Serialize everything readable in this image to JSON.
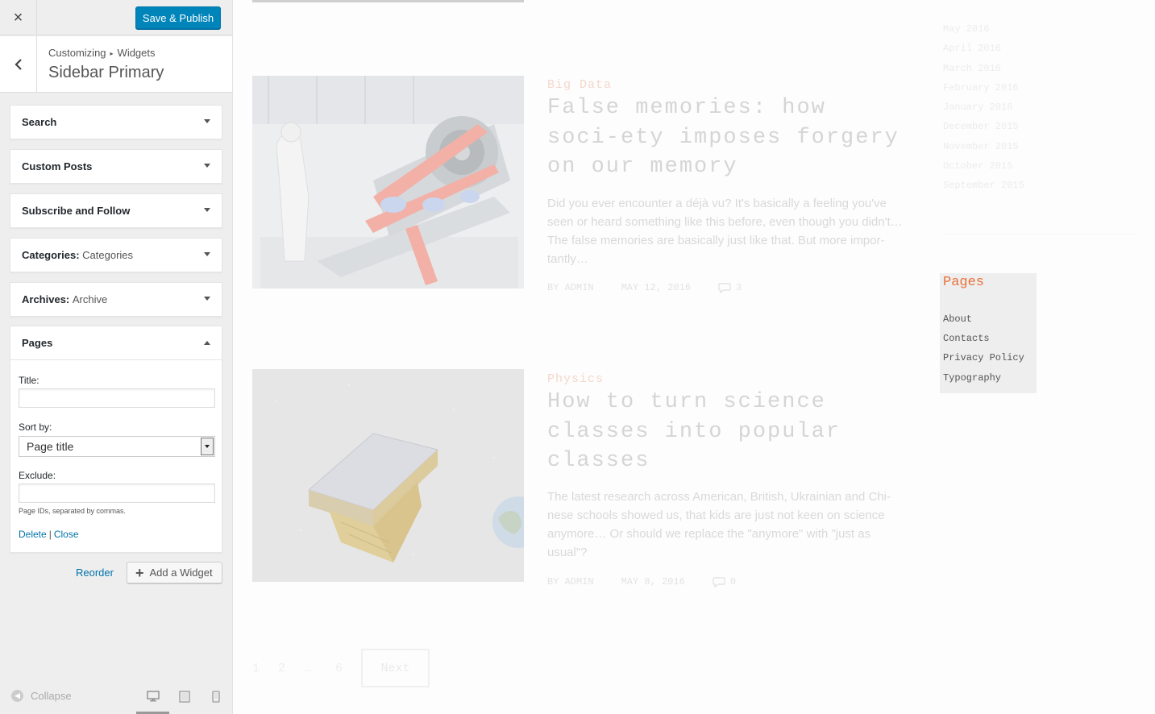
{
  "customizer": {
    "close_label": "×",
    "save_label": "Save & Publish",
    "breadcrumb": {
      "root": "Customizing",
      "separator": "▸",
      "section": "Widgets"
    },
    "section_title": "Sidebar Primary",
    "widgets": [
      {
        "title": "Search",
        "subtitle": ""
      },
      {
        "title": "Custom Posts",
        "subtitle": ""
      },
      {
        "title": "Subscribe and Follow",
        "subtitle": ""
      },
      {
        "title": "Categories:",
        "subtitle": "Categories"
      },
      {
        "title": "Archives:",
        "subtitle": "Archive"
      }
    ],
    "open_widget": {
      "title": "Pages",
      "title_label": "Title:",
      "title_value": "",
      "sort_label": "Sort by:",
      "sort_value": "Page title",
      "exclude_label": "Exclude:",
      "exclude_value": "",
      "hint": "Page IDs, separated by commas.",
      "delete_label": "Delete",
      "link_separator": "|",
      "close_label": "Close"
    },
    "reorder_label": "Reorder",
    "add_widget_label": "Add a Widget",
    "collapse_label": "Collapse",
    "devices": [
      "desktop-icon",
      "tablet-icon",
      "mobile-icon"
    ],
    "accent_color": "#0085ba"
  },
  "preview": {
    "posts": [
      {
        "category": "Big Data",
        "title": "False memories: how soci-ety imposes forgery on our memory",
        "excerpt": "Did you ever encounter a déjà vu? It's basically a feeling you've seen or heard something like this before, even though you didn't… The false memories are basically just like that. But more impor-tantly…",
        "author": "BY ADMIN",
        "date": "MAY 12, 2016",
        "comments": "3"
      },
      {
        "category": "Physics",
        "title": "How to turn science classes into popular classes",
        "excerpt": "The latest research across American, British, Ukrainian and Chi-nese schools showed us, that kids are just not keen on science anymore… Or should we replace the \"anymore\" with \"just as usual\"?",
        "author": "BY ADMIN",
        "date": "MAY 8, 2016",
        "comments": "0"
      }
    ],
    "pagination": {
      "pages": [
        "1",
        "2",
        "…",
        "6"
      ],
      "next_label": "Next"
    },
    "archives": [
      "May 2016",
      "April 2016",
      "March 2016",
      "February 2016",
      "January 2016",
      "December 2015",
      "November 2015",
      "October 2015",
      "September 2015"
    ],
    "pages_widget": {
      "heading": "Pages",
      "items": [
        "About",
        "Contacts",
        "Privacy Policy",
        "Typography"
      ]
    },
    "heading_color": "#e8703a"
  }
}
